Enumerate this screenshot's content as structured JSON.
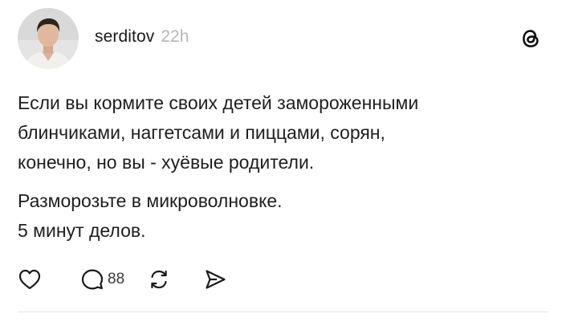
{
  "post": {
    "username": "serditov",
    "time": "22h",
    "text_lines": [
      "Если вы кормите своих детей замороженными",
      "блинчиками, наггетсами и пиццами, сорян,",
      "конечно, но вы - хуёвые родители."
    ],
    "text2_lines": [
      "Разморозьте в микроволновке.",
      "5 минут делов."
    ],
    "reply_count": "88"
  },
  "icons": {
    "app_logo": "threads-logo-icon",
    "like": "heart-icon",
    "reply": "comment-bubble-icon",
    "repost": "repost-icon",
    "share": "send-icon"
  }
}
